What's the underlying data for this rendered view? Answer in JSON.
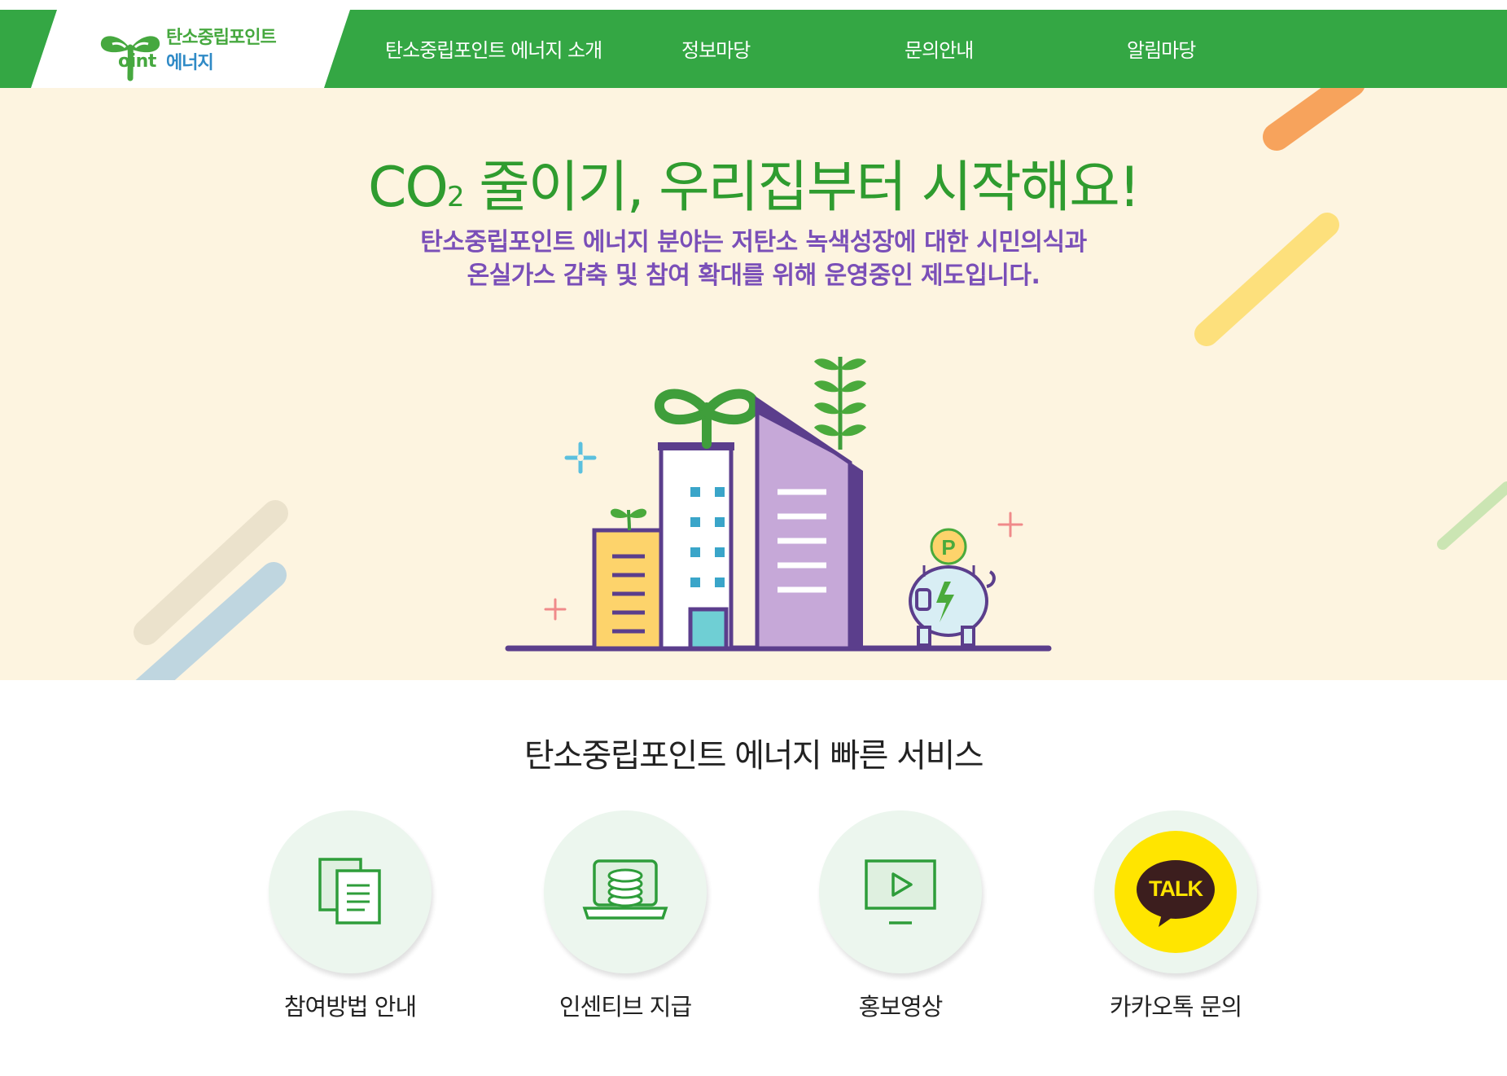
{
  "header": {
    "logo": {
      "line1": "탄소중립포인트",
      "point_word": "oint",
      "line2": "에너지"
    },
    "nav": [
      {
        "label": "탄소중립포인트 에너지 소개"
      },
      {
        "label": "정보마당"
      },
      {
        "label": "문의안내"
      },
      {
        "label": "알림마당"
      }
    ]
  },
  "hero": {
    "title_prefix": "CO",
    "title_sub": "2",
    "title_rest": " 줄이기, 우리집부터 시작해요!",
    "desc_line1": "탄소중립포인트 에너지 분야는 저탄소 녹색성장에 대한 시민의식과",
    "desc_line2": "온실가스 감축 및 참여 확대를 위해 운영중인 제도입니다.",
    "coin_letter": "P"
  },
  "quick_services": {
    "title": "탄소중립포인트 에너지 빠른 서비스",
    "items": [
      {
        "label": "참여방법 안내",
        "icon": "documents-icon"
      },
      {
        "label": "인센티브 지급",
        "icon": "coins-laptop-icon"
      },
      {
        "label": "홍보영상",
        "icon": "video-play-icon"
      },
      {
        "label": "카카오톡 문의",
        "icon": "kakaotalk-icon",
        "badge": "TALK"
      }
    ]
  },
  "colors": {
    "brand_green": "#34a744",
    "hero_background": "#fdf4e0",
    "hero_title": "#2f9c2f",
    "hero_desc": "#7a4fb8",
    "kakao_yellow": "#ffe500"
  }
}
